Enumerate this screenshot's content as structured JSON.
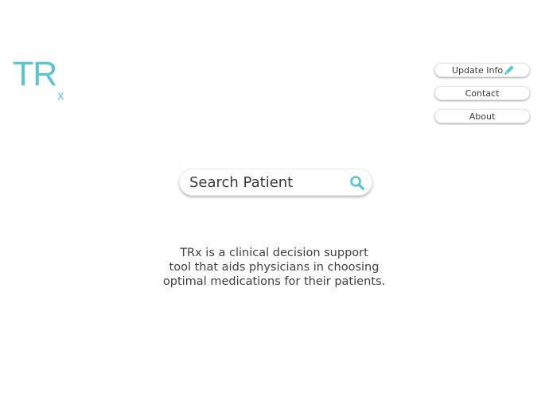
{
  "logo": {
    "main": "TR",
    "subscript": "x"
  },
  "nav": {
    "update_info": "Update Info",
    "contact": "Contact",
    "about": "About"
  },
  "search": {
    "placeholder": "Search Patient"
  },
  "description": {
    "lines": [
      "TRx is a clinical decision support",
      "tool that aids physicians in choosing",
      "optimal medications for their patients."
    ]
  },
  "colors": {
    "accent": "#5bc4cf",
    "text": "#3f3f3f",
    "background": "#ffffff"
  },
  "icons": {
    "update_info": "pencil-icon",
    "search": "search-icon"
  }
}
